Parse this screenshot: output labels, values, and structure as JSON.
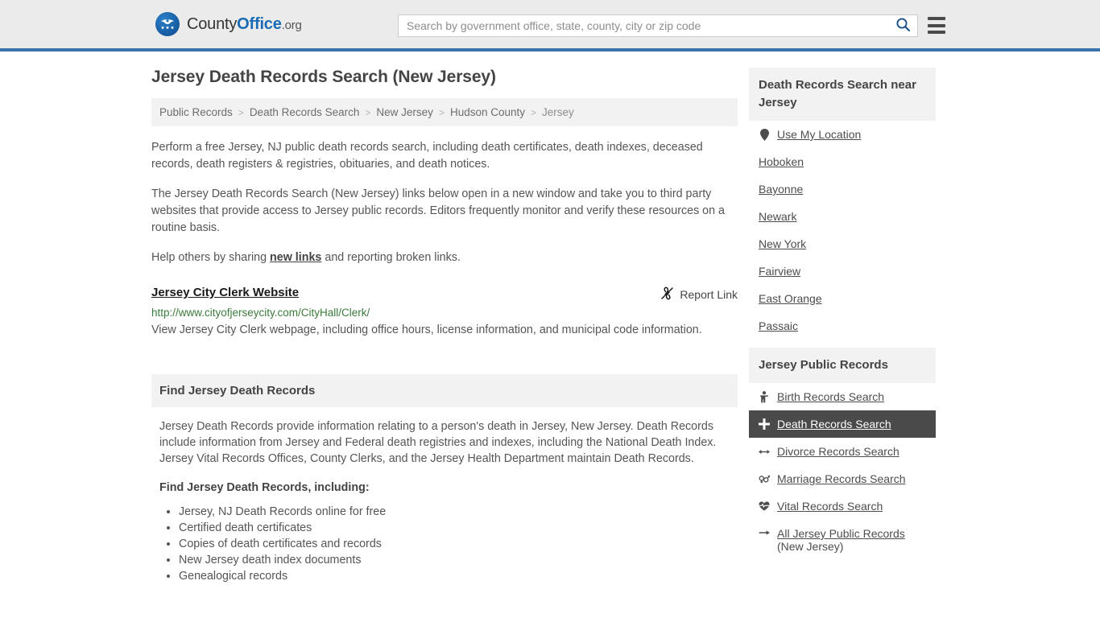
{
  "header": {
    "logo": {
      "part1": "County",
      "part2": "Office",
      "tld": ".org",
      "icon": "eagle-stars-icon"
    },
    "search": {
      "placeholder": "Search by government office, state, county, city or zip code",
      "value": "",
      "search_icon": "search-icon"
    },
    "menu_icon": "hamburger-menu-icon",
    "accent_color": "#3a74a8"
  },
  "main": {
    "title": "Jersey Death Records Search (New Jersey)",
    "breadcrumb": [
      {
        "label": "Public Records",
        "current": false
      },
      {
        "label": "Death Records Search",
        "current": false
      },
      {
        "label": "New Jersey",
        "current": false
      },
      {
        "label": "Hudson County",
        "current": false
      },
      {
        "label": "Jersey",
        "current": true
      }
    ],
    "breadcrumb_separator": ">",
    "intro_1": "Perform a free Jersey, NJ public death records search, including death certificates, death indexes, deceased records, death registers & registries, obituaries, and death notices.",
    "intro_2": "The Jersey Death Records Search (New Jersey) links below open in a new window and take you to third party websites that provide access to Jersey public records. Editors frequently monitor and verify these resources on a routine basis.",
    "help_prefix": "Help others by sharing ",
    "help_link": "new links",
    "help_suffix": " and reporting broken links.",
    "result": {
      "title": "Jersey City Clerk Website",
      "report_label": "Report Link",
      "report_icon": "broken-link-icon",
      "url": "http://www.cityofjerseycity.com/CityHall/Clerk/",
      "url_color": "#3c7a3c",
      "description": "View Jersey City Clerk webpage, including office hours, license information, and municipal code information."
    },
    "section": {
      "heading": "Find Jersey Death Records",
      "paragraph": "Jersey Death Records provide information relating to a person's death in Jersey, New Jersey. Death Records include information from Jersey and Federal death registries and indexes, including the National Death Index. Jersey Vital Records Offices, County Clerks, and the Jersey Health Department maintain Death Records.",
      "list_heading": "Find Jersey Death Records, including:",
      "list": [
        "Jersey, NJ Death Records online for free",
        "Certified death certificates",
        "Copies of death certificates and records",
        "New Jersey death index documents",
        "Genealogical records"
      ]
    }
  },
  "sidebar": {
    "nearby": {
      "heading": "Death Records Search near Jersey",
      "use_my_location": {
        "label": "Use My Location",
        "icon": "map-pin-icon"
      },
      "cities": [
        "Hoboken",
        "Bayonne",
        "Newark",
        "New York",
        "Fairview",
        "East Orange",
        "Passaic"
      ]
    },
    "public_records": {
      "heading": "Jersey Public Records",
      "active_color": "#4a4a4a",
      "items": [
        {
          "label": "Birth Records Search",
          "icon": "baby-icon",
          "glyph": "♀",
          "active": false
        },
        {
          "label": "Death Records Search",
          "icon": "cross-icon",
          "glyph": "✚",
          "active": true
        },
        {
          "label": "Divorce Records Search",
          "icon": "split-arrows-icon",
          "glyph": "↔",
          "active": false
        },
        {
          "label": "Marriage Records Search",
          "icon": "gender-symbols-icon",
          "glyph": "⚥",
          "active": false
        },
        {
          "label": "Vital Records Search",
          "icon": "heartbeat-icon",
          "glyph": "♥",
          "active": false
        },
        {
          "label": "All Jersey Public Records",
          "label_line2": "(New Jersey)",
          "icon": "arrow-right-icon",
          "glyph": "→",
          "active": false
        }
      ]
    }
  }
}
